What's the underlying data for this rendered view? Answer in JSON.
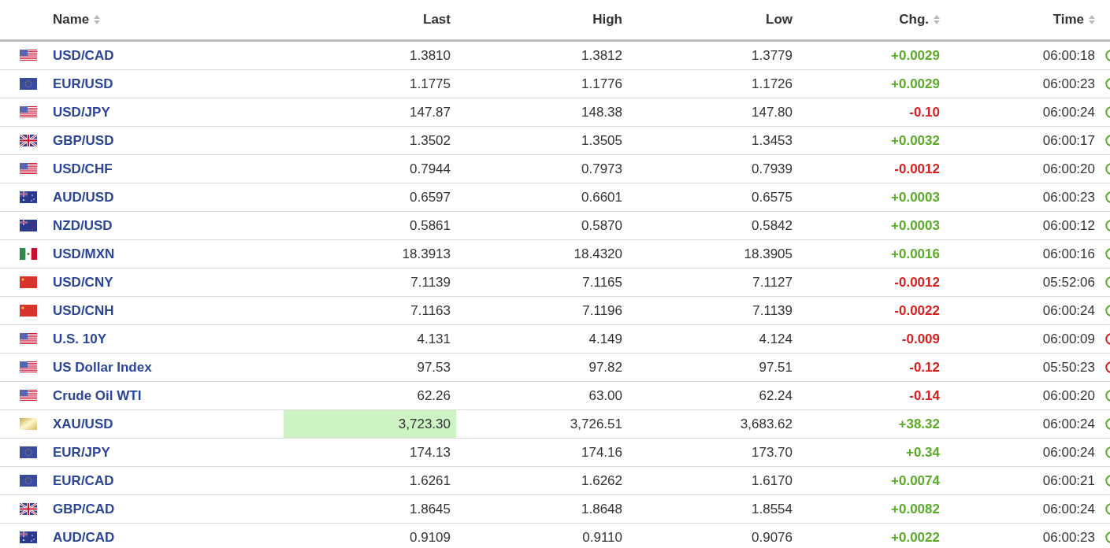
{
  "table": {
    "columns": [
      {
        "label": "Name",
        "sortable": true
      },
      {
        "label": "Last",
        "sortable": false
      },
      {
        "label": "High",
        "sortable": false
      },
      {
        "label": "Low",
        "sortable": false
      },
      {
        "label": "Chg.",
        "sortable": true
      },
      {
        "label": "Time",
        "sortable": true
      }
    ],
    "rows": [
      {
        "kind": "us",
        "name": "USD/CAD",
        "last": "1.3810",
        "high": "1.3812",
        "low": "1.3779",
        "chg": "+0.0029",
        "positive": true,
        "time": "06:00:18",
        "flash": false,
        "market_open": true
      },
      {
        "kind": "eu",
        "name": "EUR/USD",
        "last": "1.1775",
        "high": "1.1776",
        "low": "1.1726",
        "chg": "+0.0029",
        "positive": true,
        "time": "06:00:23",
        "flash": false,
        "market_open": true
      },
      {
        "kind": "us",
        "name": "USD/JPY",
        "last": "147.87",
        "high": "148.38",
        "low": "147.80",
        "chg": "-0.10",
        "positive": false,
        "time": "06:00:24",
        "flash": false,
        "market_open": true
      },
      {
        "kind": "gb",
        "name": "GBP/USD",
        "last": "1.3502",
        "high": "1.3505",
        "low": "1.3453",
        "chg": "+0.0032",
        "positive": true,
        "time": "06:00:17",
        "flash": false,
        "market_open": true
      },
      {
        "kind": "us",
        "name": "USD/CHF",
        "last": "0.7944",
        "high": "0.7973",
        "low": "0.7939",
        "chg": "-0.0012",
        "positive": false,
        "time": "06:00:20",
        "flash": false,
        "market_open": true
      },
      {
        "kind": "au",
        "name": "AUD/USD",
        "last": "0.6597",
        "high": "0.6601",
        "low": "0.6575",
        "chg": "+0.0003",
        "positive": true,
        "time": "06:00:23",
        "flash": false,
        "market_open": true
      },
      {
        "kind": "nz",
        "name": "NZD/USD",
        "last": "0.5861",
        "high": "0.5870",
        "low": "0.5842",
        "chg": "+0.0003",
        "positive": true,
        "time": "06:00:12",
        "flash": false,
        "market_open": true
      },
      {
        "kind": "mx",
        "name": "USD/MXN",
        "last": "18.3913",
        "high": "18.4320",
        "low": "18.3905",
        "chg": "+0.0016",
        "positive": true,
        "time": "06:00:16",
        "flash": false,
        "market_open": true
      },
      {
        "kind": "cn",
        "name": "USD/CNY",
        "last": "7.1139",
        "high": "7.1165",
        "low": "7.1127",
        "chg": "-0.0012",
        "positive": false,
        "time": "05:52:06",
        "flash": false,
        "market_open": true
      },
      {
        "kind": "cn",
        "name": "USD/CNH",
        "last": "7.1163",
        "high": "7.1196",
        "low": "7.1139",
        "chg": "-0.0022",
        "positive": false,
        "time": "06:00:24",
        "flash": false,
        "market_open": true
      },
      {
        "kind": "us",
        "name": "U.S. 10Y",
        "last": "4.131",
        "high": "4.149",
        "low": "4.124",
        "chg": "-0.009",
        "positive": false,
        "time": "06:00:09",
        "flash": false,
        "market_open": false
      },
      {
        "kind": "us",
        "name": "US Dollar Index",
        "last": "97.53",
        "high": "97.82",
        "low": "97.51",
        "chg": "-0.12",
        "positive": false,
        "time": "05:50:23",
        "flash": false,
        "market_open": false
      },
      {
        "kind": "us",
        "name": "Crude Oil WTI",
        "last": "62.26",
        "high": "63.00",
        "low": "62.24",
        "chg": "-0.14",
        "positive": false,
        "time": "06:00:20",
        "flash": false,
        "market_open": true
      },
      {
        "kind": "gold",
        "name": "XAU/USD",
        "last": "3,723.30",
        "high": "3,726.51",
        "low": "3,683.62",
        "chg": "+38.32",
        "positive": true,
        "time": "06:00:24",
        "flash": true,
        "market_open": true
      },
      {
        "kind": "eu",
        "name": "EUR/JPY",
        "last": "174.13",
        "high": "174.16",
        "low": "173.70",
        "chg": "+0.34",
        "positive": true,
        "time": "06:00:24",
        "flash": false,
        "market_open": true
      },
      {
        "kind": "eu",
        "name": "EUR/CAD",
        "last": "1.6261",
        "high": "1.6262",
        "low": "1.6170",
        "chg": "+0.0074",
        "positive": true,
        "time": "06:00:21",
        "flash": false,
        "market_open": true
      },
      {
        "kind": "gb",
        "name": "GBP/CAD",
        "last": "1.8645",
        "high": "1.8648",
        "low": "1.8554",
        "chg": "+0.0082",
        "positive": true,
        "time": "06:00:24",
        "flash": false,
        "market_open": true
      },
      {
        "kind": "au",
        "name": "AUD/CAD",
        "last": "0.9109",
        "high": "0.9110",
        "low": "0.9076",
        "chg": "+0.0022",
        "positive": true,
        "time": "06:00:23",
        "flash": false,
        "market_open": true
      }
    ]
  }
}
